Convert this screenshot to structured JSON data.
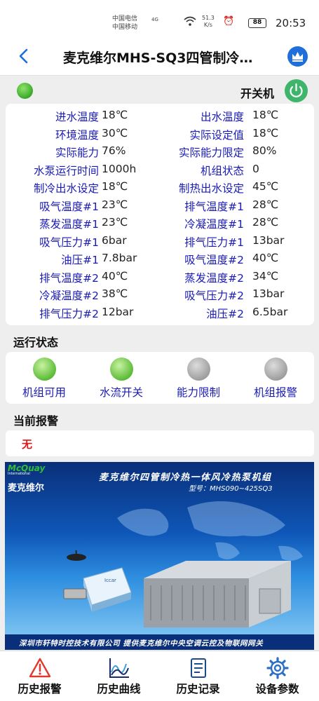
{
  "status_bar": {
    "carrier1": "中国电信",
    "carrier2": "中国移动",
    "net_type": "4G",
    "speed_value": "51.3",
    "speed_unit": "K/s",
    "battery": "88",
    "time": "20:53"
  },
  "header": {
    "title": "麦克维尔MHS-SQ3四管制冷…"
  },
  "power": {
    "label": "开关机",
    "led_color": "#44b832",
    "button_color": "#3fb56b"
  },
  "params": [
    {
      "label1": "进水温度",
      "value1": "18℃",
      "label2": "出水温度",
      "value2": "18℃"
    },
    {
      "label1": "环境温度",
      "value1": "30℃",
      "label2": "实际设定值",
      "value2": "18℃"
    },
    {
      "label1": "实际能力",
      "value1": "76%",
      "label2": "实际能力限定",
      "value2": "80%"
    },
    {
      "label1": "水泵运行时间",
      "value1": "1000h",
      "label2": "机组状态",
      "value2": "0"
    },
    {
      "label1": "制冷出水设定",
      "value1": "18℃",
      "label2": "制热出水设定",
      "value2": "45℃"
    },
    {
      "label1": "吸气温度#1",
      "value1": "23℃",
      "label2": "排气温度#1",
      "value2": "28℃"
    },
    {
      "label1": "蒸发温度#1",
      "value1": "23℃",
      "label2": "冷凝温度#1",
      "value2": "28℃"
    },
    {
      "label1": "吸气压力#1",
      "value1": "6bar",
      "label2": "排气压力#1",
      "value2": "13bar"
    },
    {
      "label1": "油压#1",
      "value1": "7.8bar",
      "label2": "吸气温度#2",
      "value2": "40℃"
    },
    {
      "label1": "排气温度#2",
      "value1": "40℃",
      "label2": "蒸发温度#2",
      "value2": "34℃"
    },
    {
      "label1": "冷凝温度#2",
      "value1": "38℃",
      "label2": "吸气压力#2",
      "value2": "13bar"
    },
    {
      "label1": "排气压力#2",
      "value1": "12bar",
      "label2": "油压#2",
      "value2": "6.5bar"
    }
  ],
  "run_status": {
    "title": "运行状态",
    "items": [
      {
        "label": "机组可用",
        "state": "on"
      },
      {
        "label": "水流开关",
        "state": "on"
      },
      {
        "label": "能力限制",
        "state": "off"
      },
      {
        "label": "机组报警",
        "state": "off"
      }
    ],
    "colors": {
      "on": "#55b830",
      "off": "#9a9a9a"
    }
  },
  "alarm": {
    "title": "当前报警",
    "text": "无",
    "text_color": "#e01515"
  },
  "banner": {
    "logo": "McQuay",
    "logo_sub": "International",
    "brand": "麦克维尔",
    "title": "麦克维尔四管制冷热一体风冷热泵机组",
    "model": "型号：MHS090~425SQ3",
    "device_label": "Iccar",
    "footer": "深圳市轩特时控技术有限公司  提供麦克维尔中央空调云控及物联网网关"
  },
  "bottom_nav": [
    {
      "label": "历史报警",
      "icon": "warning-icon"
    },
    {
      "label": "历史曲线",
      "icon": "chart-icon"
    },
    {
      "label": "历史记录",
      "icon": "document-icon"
    },
    {
      "label": "设备参数",
      "icon": "gear-icon"
    }
  ]
}
